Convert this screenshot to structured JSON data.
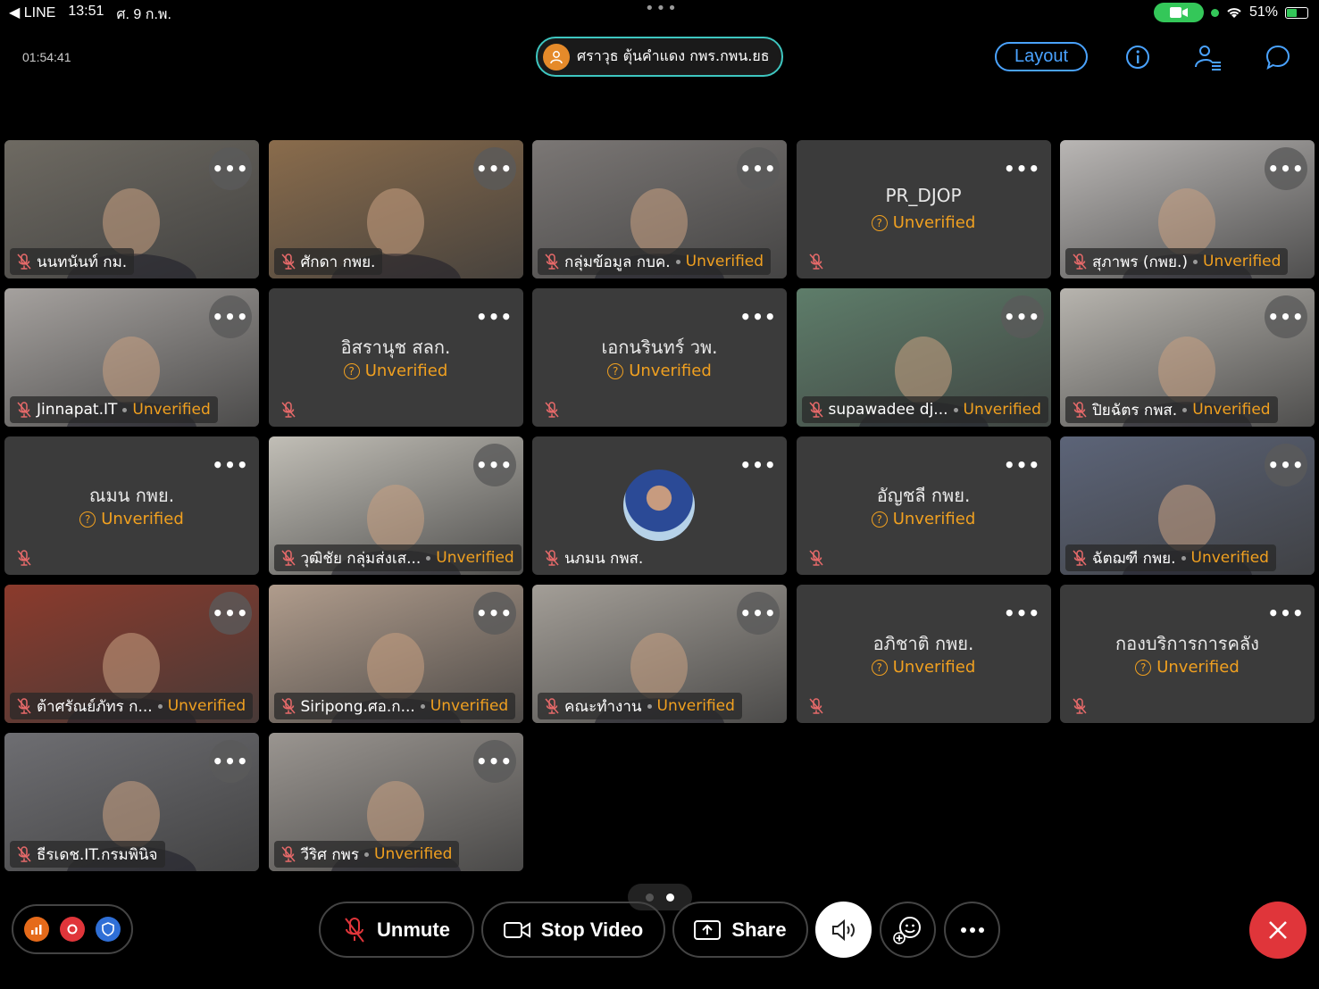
{
  "status_bar": {
    "back_app": "◀ LINE",
    "time": "13:51",
    "date": "ศ. 9 ก.พ.",
    "battery": "51%"
  },
  "header": {
    "timer": "01:54:41",
    "active_speaker": "ศราวุธ ตุ้นคำแดง กพร.กพน.ยธ",
    "layout_label": "Layout"
  },
  "tiles": [
    {
      "name": "นนทนันท์ กม.",
      "status": "",
      "mode": "video",
      "bg": "#6e6a62"
    },
    {
      "name": "ศักดา กพย.",
      "status": "",
      "mode": "video",
      "bg": "#8a6c4c"
    },
    {
      "name": "กลุ่มข้อมูล กบค.",
      "status": "Unverified",
      "mode": "video",
      "bg": "#7b7775"
    },
    {
      "name": "PR_DJOP",
      "status": "Unverified",
      "mode": "center"
    },
    {
      "name": "สุภาพร (กพย.)",
      "status": "Unverified",
      "mode": "video",
      "bg": "#b9b6b4"
    },
    {
      "name": "Jinnapat.IT",
      "status": "Unverified",
      "mode": "video",
      "bg": "#a5a19e"
    },
    {
      "name": "อิสรานุช สลก.",
      "status": "Unverified",
      "mode": "center"
    },
    {
      "name": "เอกนรินทร์ วพ.",
      "status": "Unverified",
      "mode": "center"
    },
    {
      "name": "supawadee dj...",
      "status": "Unverified",
      "mode": "video",
      "bg": "#5e7d6a"
    },
    {
      "name": "ปิยฉัตร กพส.",
      "status": "Unverified",
      "mode": "video",
      "bg": "#b7b4ae"
    },
    {
      "name": "ณมน กพย.",
      "status": "Unverified",
      "mode": "center"
    },
    {
      "name": "วุฒิชัย กลุ่มส่งเส...",
      "status": "Unverified",
      "mode": "video",
      "bg": "#c1beb6"
    },
    {
      "name": "นภมน กพส.",
      "status": "",
      "mode": "avatar"
    },
    {
      "name": "อัญชลี กพย.",
      "status": "Unverified",
      "mode": "center"
    },
    {
      "name": "ฉัตฌฑี กพย.",
      "status": "Unverified",
      "mode": "video",
      "bg": "#5c6478"
    },
    {
      "name": "ต้าศรัณย์ภัทร ก...",
      "status": "Unverified",
      "mode": "video",
      "bg": "#8b3a2c"
    },
    {
      "name": "Siripong.ศอ.ก...",
      "status": "Unverified",
      "mode": "video",
      "bg": "#b09c8c"
    },
    {
      "name": "คณะทำงาน",
      "status": "Unverified",
      "mode": "video",
      "bg": "#a39e97"
    },
    {
      "name": "อภิชาติ กพย.",
      "status": "Unverified",
      "mode": "center"
    },
    {
      "name": "กองบริการการคลัง",
      "status": "Unverified",
      "mode": "center"
    },
    {
      "name": "ธีรเดช.IT.กรมพินิจ",
      "status": "",
      "mode": "video",
      "bg": "#6e6e72"
    },
    {
      "name": "วีริศ กพร",
      "status": "Unverified",
      "mode": "video",
      "bg": "#9a9590"
    }
  ],
  "toolbar": {
    "unmute": "Unmute",
    "stop_video": "Stop Video",
    "share": "Share"
  },
  "colors": {
    "accent_blue": "#4aa3ff",
    "unverified": "#f0a020",
    "end_call": "#e0353a",
    "tile_bg": "#3b3b3b"
  }
}
